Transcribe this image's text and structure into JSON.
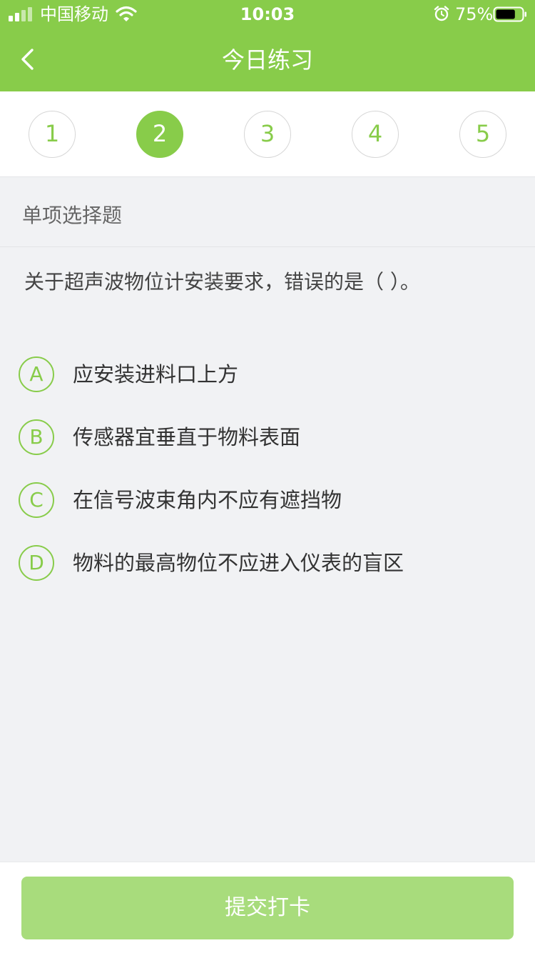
{
  "status_bar": {
    "carrier": "中国移动",
    "time": "10:03",
    "battery_percent": "75%",
    "battery_level": 0.75,
    "icons": [
      "signal-icon",
      "wifi-icon",
      "alarm-icon",
      "battery-icon"
    ]
  },
  "nav": {
    "title": "今日练习",
    "back_icon": "chevron-left-icon"
  },
  "steps": [
    "1",
    "2",
    "3",
    "4",
    "5"
  ],
  "active_step": "2",
  "question": {
    "type": "单项选择题",
    "text": "关于超声波物位计安装要求，错误的是（    ）。",
    "options": [
      {
        "letter": "A",
        "text": "应安装进料口上方"
      },
      {
        "letter": "B",
        "text": "传感器宜垂直于物料表面"
      },
      {
        "letter": "C",
        "text": "在信号波束角内不应有遮挡物"
      },
      {
        "letter": "D",
        "text": "物料的最高物位不应进入仪表的盲区"
      }
    ]
  },
  "footer": {
    "submit_label": "提交打卡"
  },
  "colors": {
    "accent": "#88cc4a",
    "button_disabled": "#a8dc7c",
    "background": "#f1f2f4"
  }
}
